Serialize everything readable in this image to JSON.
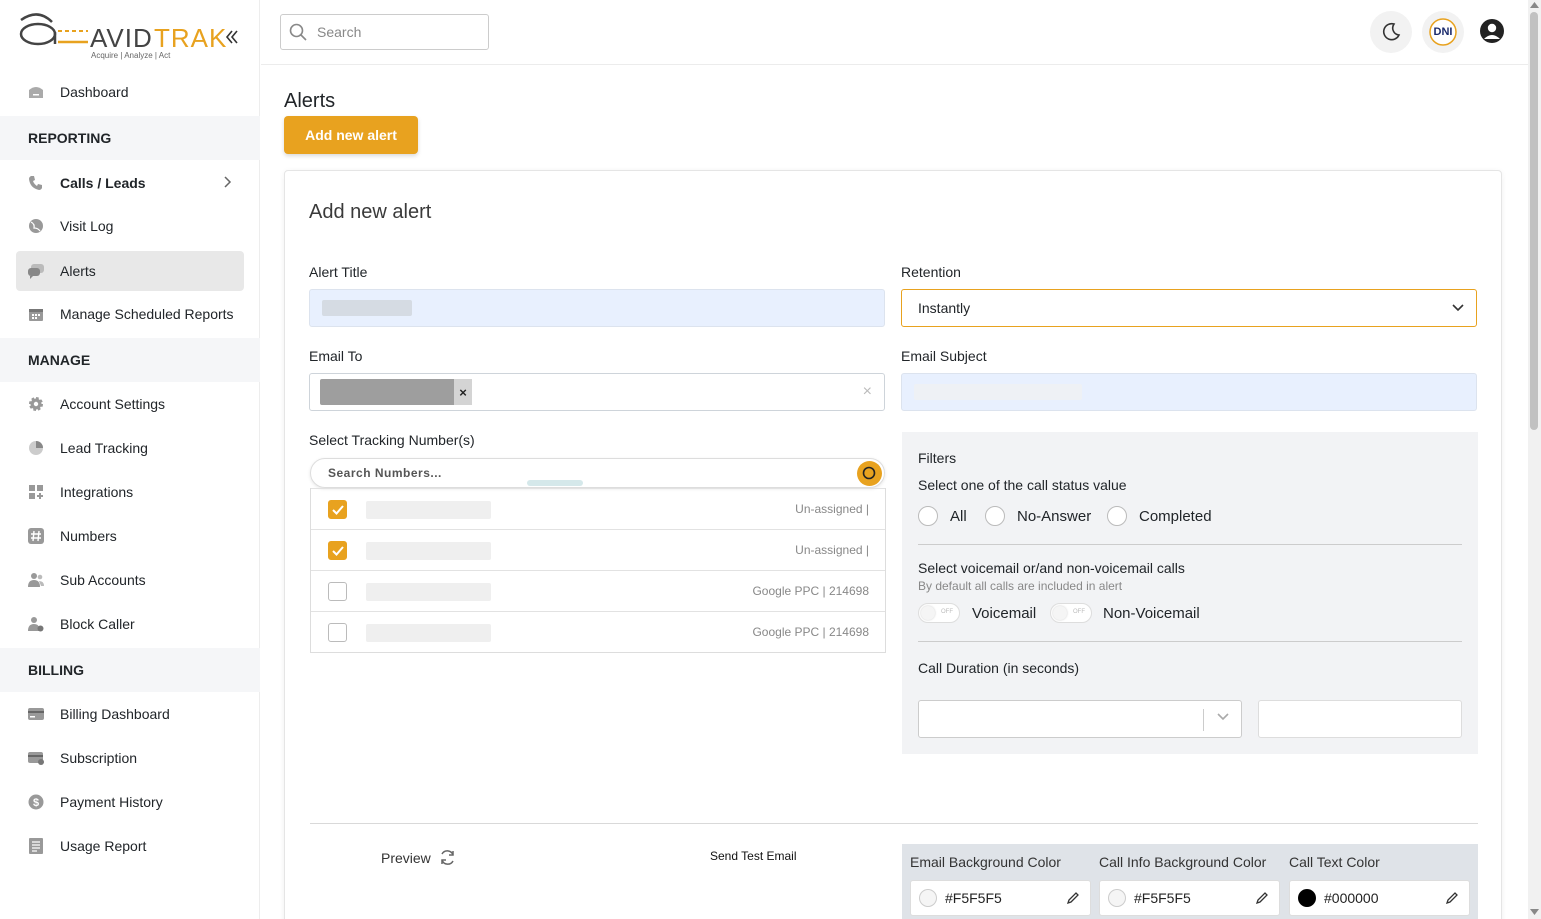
{
  "brand": {
    "name": "AVIDTRAK",
    "tagline": "Acquire  |  Analyze  |  Act",
    "accent": "#e8a21f"
  },
  "sidebar": {
    "items_top": [
      {
        "label": "Dashboard",
        "icon": "home-icon"
      }
    ],
    "sections": [
      {
        "title": "REPORTING",
        "items": [
          {
            "label": "Calls / Leads",
            "icon": "phone-icon"
          },
          {
            "label": "Visit Log",
            "icon": "globe-icon"
          },
          {
            "label": "Alerts",
            "icon": "chat-icon"
          },
          {
            "label": "Manage Scheduled Reports",
            "icon": "calendar-icon"
          }
        ]
      },
      {
        "title": "MANAGE",
        "items": [
          {
            "label": "Account Settings",
            "icon": "gear-icon"
          },
          {
            "label": "Lead Tracking",
            "icon": "pie-icon"
          },
          {
            "label": "Integrations",
            "icon": "grid-plus-icon"
          },
          {
            "label": "Numbers",
            "icon": "hash-icon"
          },
          {
            "label": "Sub Accounts",
            "icon": "users-icon"
          },
          {
            "label": "Block Caller",
            "icon": "user-block-icon"
          }
        ]
      },
      {
        "title": "BILLING",
        "items": [
          {
            "label": "Billing Dashboard",
            "icon": "card-icon"
          },
          {
            "label": "Subscription",
            "icon": "subscription-icon"
          },
          {
            "label": "Payment History",
            "icon": "dollar-icon"
          },
          {
            "label": "Usage Report",
            "icon": "report-icon"
          }
        ]
      }
    ]
  },
  "topbar": {
    "search_placeholder": "Search",
    "dni_label": "DNI"
  },
  "page": {
    "title": "Alerts",
    "add_button": "Add new alert"
  },
  "form": {
    "title": "Add new alert",
    "alert_title_label": "Alert Title",
    "retention_label": "Retention",
    "retention_value": "Instantly",
    "email_to_label": "Email To",
    "email_subject_label": "Email Subject",
    "tracking_label": "Select Tracking Number(s)",
    "numbers_search_placeholder": "Search Numbers...",
    "numbers": [
      {
        "checked": true,
        "source": "Un-assigned |"
      },
      {
        "checked": true,
        "source": "Un-assigned |"
      },
      {
        "checked": false,
        "source": "Google PPC | 214698"
      },
      {
        "checked": false,
        "source": "Google PPC | 214698"
      }
    ],
    "filters": {
      "title": "Filters",
      "status_label": "Select one of the call status value",
      "status_options": [
        "All",
        "No-Answer",
        "Completed"
      ],
      "voicemail_label": "Select voicemail or/and non-voicemail calls",
      "voicemail_note": "By default all calls are included in alert",
      "toggle_off": "OFF",
      "voicemail": "Voicemail",
      "non_voicemail": "Non-Voicemail",
      "duration_label": "Call Duration (in seconds)"
    },
    "preview_label": "Preview",
    "send_test_label": "Send Test Email",
    "colors": [
      {
        "label": "Email Background Color",
        "value": "#F5F5F5"
      },
      {
        "label": "Call Info Background Color",
        "value": "#F5F5F5"
      },
      {
        "label": "Call Text Color",
        "value": "#000000"
      }
    ]
  }
}
